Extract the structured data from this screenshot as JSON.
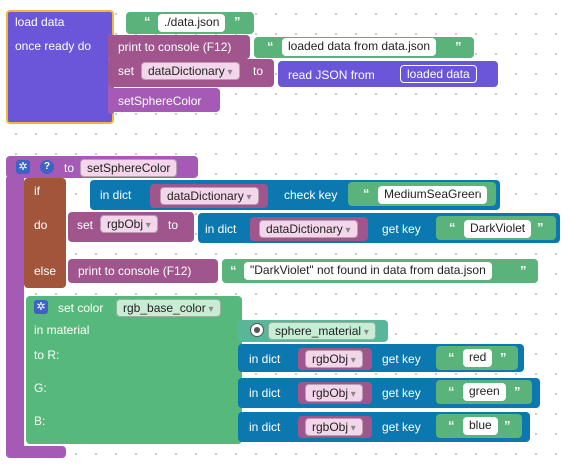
{
  "block1": {
    "load_data": "load data",
    "path": "./data.json",
    "once_ready": "once ready do",
    "print_label": "print to console (F12)",
    "print_text": "loaded data from data.json",
    "set_label": "set",
    "set_var": "dataDictionary",
    "to_label": "to",
    "read_json": "read JSON from",
    "read_var": "loaded data",
    "call_label": "setSphereColor"
  },
  "block2": {
    "to_label": "to",
    "proc_name": "setSphereColor",
    "if_label": "if",
    "in_dict": "in dict",
    "dict_var": "dataDictionary",
    "check_key": "check key",
    "check_text": "MediumSeaGreen",
    "do_label": "do",
    "set_label": "set",
    "rgb_var": "rgbObj",
    "to2": "to",
    "get_key": "get key",
    "get_text": "DarkViolet",
    "else_label": "else",
    "print_label": "print to console (F12)",
    "print_text": "\"DarkViolet\" not found in data from data.json",
    "set_color": "set color",
    "color_field": "rgb_base_color",
    "in_material": "in material",
    "material": "sphere_material",
    "to_r": "to R:",
    "g": "G:",
    "b": "B:",
    "red": "red",
    "green": "green",
    "blue": "blue"
  }
}
